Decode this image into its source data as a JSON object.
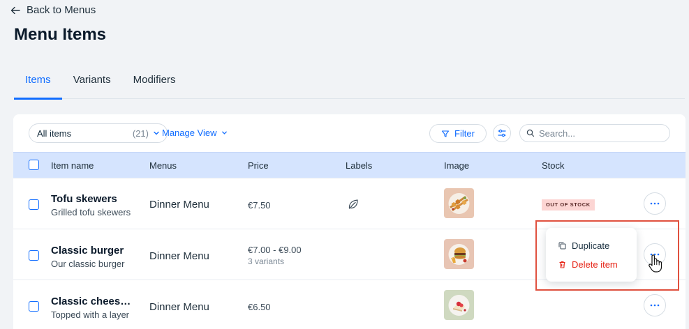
{
  "nav": {
    "back_label": "Back to Menus"
  },
  "page": {
    "title": "Menu Items"
  },
  "tabs": [
    {
      "label": "Items",
      "active": true
    },
    {
      "label": "Variants",
      "active": false
    },
    {
      "label": "Modifiers",
      "active": false
    }
  ],
  "toolbar": {
    "view_select": {
      "value": "All items",
      "count": "(21)"
    },
    "manage_view_label": "Manage View",
    "filter_label": "Filter",
    "search_placeholder": "Search..."
  },
  "table": {
    "columns": [
      "Item name",
      "Menus",
      "Price",
      "Labels",
      "Image",
      "Stock"
    ],
    "rows": [
      {
        "name": "Tofu skewers",
        "description": "Grilled tofu skewers",
        "menu": "Dinner Menu",
        "price": "€7.50",
        "variants": "",
        "label_icon": "leaf-icon",
        "image": "tofu-skewers-photo",
        "stock": "OUT OF STOCK"
      },
      {
        "name": "Classic burger",
        "description": "Our classic burger",
        "menu": "Dinner Menu",
        "price": "€7.00 - €9.00",
        "variants": "3 variants",
        "label_icon": "",
        "image": "burger-photo",
        "stock": ""
      },
      {
        "name": "Classic cheesecake",
        "description": "Topped with a layer",
        "menu": "Dinner Menu",
        "price": "€6.50",
        "variants": "",
        "label_icon": "",
        "image": "cheesecake-photo",
        "stock": ""
      }
    ]
  },
  "context_menu": {
    "duplicate_label": "Duplicate",
    "delete_label": "Delete item"
  },
  "colors": {
    "accent": "#116dff",
    "header_bg": "#d5e4fe",
    "danger": "#e62214",
    "badge_bg": "#fcd5d3",
    "highlight": "#e0513f"
  }
}
